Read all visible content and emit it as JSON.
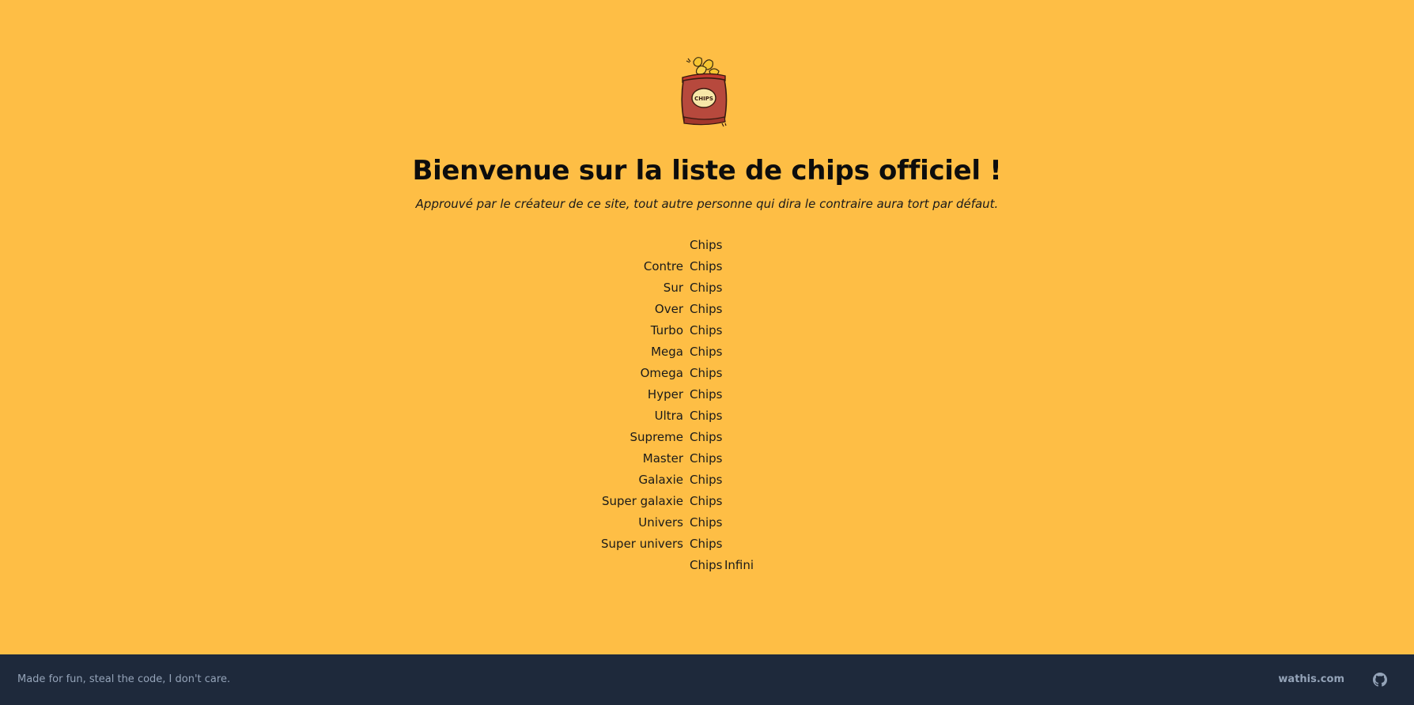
{
  "header": {
    "title": "Bienvenue sur la liste de chips officiel !",
    "subtitle": "Approuvé par le créateur de ce site, tout autre personne qui dira le contraire aura tort par défaut.",
    "logo_icon": "chips-bag-icon",
    "logo_text": "CHIPS"
  },
  "chips_list": [
    {
      "prefix": "",
      "word": "Chips",
      "suffix": ""
    },
    {
      "prefix": "Contre",
      "word": "Chips",
      "suffix": ""
    },
    {
      "prefix": "Sur",
      "word": "Chips",
      "suffix": ""
    },
    {
      "prefix": "Over",
      "word": "Chips",
      "suffix": ""
    },
    {
      "prefix": "Turbo",
      "word": "Chips",
      "suffix": ""
    },
    {
      "prefix": "Mega",
      "word": "Chips",
      "suffix": ""
    },
    {
      "prefix": "Omega",
      "word": "Chips",
      "suffix": ""
    },
    {
      "prefix": "Hyper",
      "word": "Chips",
      "suffix": ""
    },
    {
      "prefix": "Ultra",
      "word": "Chips",
      "suffix": ""
    },
    {
      "prefix": "Supreme",
      "word": "Chips",
      "suffix": ""
    },
    {
      "prefix": "Master",
      "word": "Chips",
      "suffix": ""
    },
    {
      "prefix": "Galaxie",
      "word": "Chips",
      "suffix": ""
    },
    {
      "prefix": "Super galaxie",
      "word": "Chips",
      "suffix": ""
    },
    {
      "prefix": "Univers",
      "word": "Chips",
      "suffix": ""
    },
    {
      "prefix": "Super univers",
      "word": "Chips",
      "suffix": ""
    },
    {
      "prefix": "",
      "word": "Chips",
      "suffix": "Infini"
    }
  ],
  "footer": {
    "text": "Made for fun, steal the code, I don't care.",
    "link_label": "wathis.com",
    "github_icon": "github-icon"
  },
  "colors": {
    "background": "#FEBE45",
    "footer_background": "#1E293B",
    "footer_text": "#94A3B8"
  }
}
